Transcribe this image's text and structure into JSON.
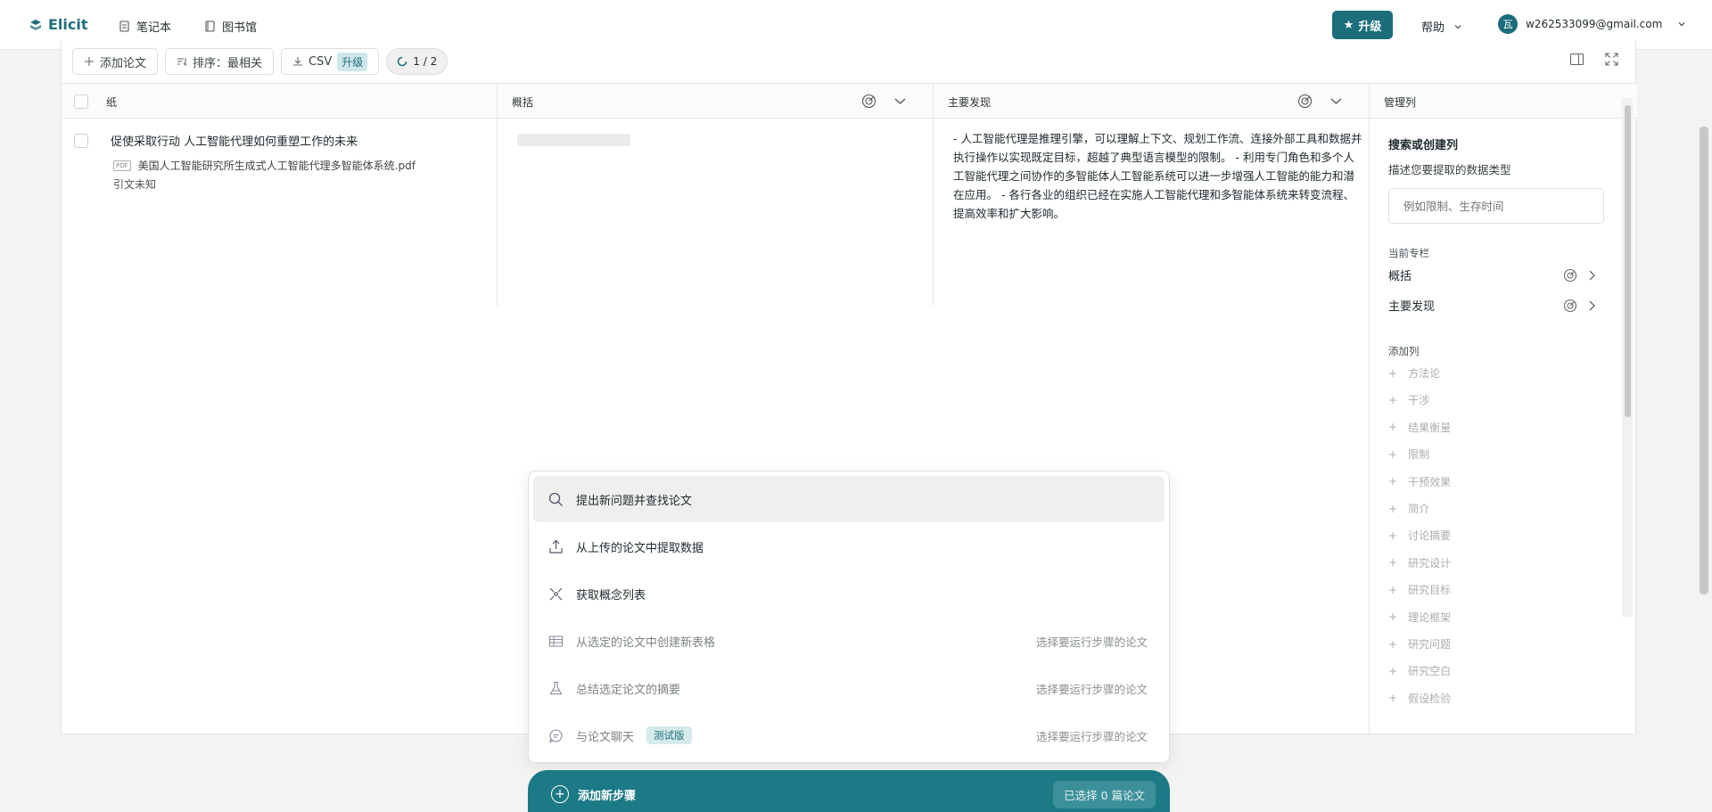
{
  "nav": {
    "logo": "Elicit",
    "notebook": "笔记本",
    "library": "图书馆",
    "upgrade": "升级",
    "help": "帮助",
    "avatar_initial": "瓦",
    "user_email": "w262533099@gmail.com"
  },
  "toolbar": {
    "add_paper": "添加论文",
    "sort": "排序：最相关",
    "csv": "CSV",
    "csv_upgrade": "升级",
    "progress": "1 / 2"
  },
  "table": {
    "columns": [
      "纸",
      "概括",
      "主要发现",
      "管理列"
    ],
    "rows": [
      {
        "title": "促使采取行动 人工智能代理如何重塑工作的未来",
        "pdf_label": "PDF",
        "pdf": "美国人工智能研究所生成式人工智能代理多智能体系统.pdf",
        "citation": "引文未知",
        "finding": "- 人工智能代理是推理引擎，可以理解上下文、规划工作流、连接外部工具和数据并执行操作以实现既定目标，超越了典型语言模型的限制。 - 利用专门角色和多个人工智能代理之间协作的多智能体人工智能系统可以进一步增强人工智能的能力和潜在应用。 - 各行各业的组织已经在实施人工智能代理和多智能体系统来转变流程、提高效率和扩大影响。"
      }
    ]
  },
  "manage": {
    "title": "搜索或创建列",
    "desc": "描述您要提取的数据类型",
    "placeholder": "例如限制、生存时间",
    "current_label": "当前专栏",
    "current": [
      "概括",
      "主要发现"
    ],
    "add_label": "添加列",
    "add_items": [
      "方法论",
      "干涉",
      "结果衡量",
      "限制",
      "干预效果",
      "简介",
      "讨论摘要",
      "研究设计",
      "研究目标",
      "理论框架",
      "研究问题",
      "研究空白",
      "假设检验"
    ]
  },
  "popup": {
    "items": [
      {
        "label": "提出新问题并查找论文",
        "hint": "",
        "icon": "search-icon"
      },
      {
        "label": "从上传的论文中提取数据",
        "hint": "",
        "icon": "upload-icon"
      },
      {
        "label": "获取概念列表",
        "hint": "",
        "icon": "concept-icon"
      },
      {
        "label": "从选定的论文中创建新表格",
        "hint": "选择要运行步骤的论文",
        "icon": "table-icon"
      },
      {
        "label": "总结选定论文的摘要",
        "hint": "选择要运行步骤的论文",
        "icon": "flask-icon"
      },
      {
        "label": "与论文聊天",
        "hint": "选择要运行步骤的论文",
        "icon": "chat-icon",
        "badge": "测试版"
      }
    ]
  },
  "addstep": {
    "label": "添加新步骤",
    "selected": "已选择 0 篇论文"
  },
  "colors": {
    "accent": "#1b6e7a",
    "accent_light": "#cfe6ea"
  }
}
